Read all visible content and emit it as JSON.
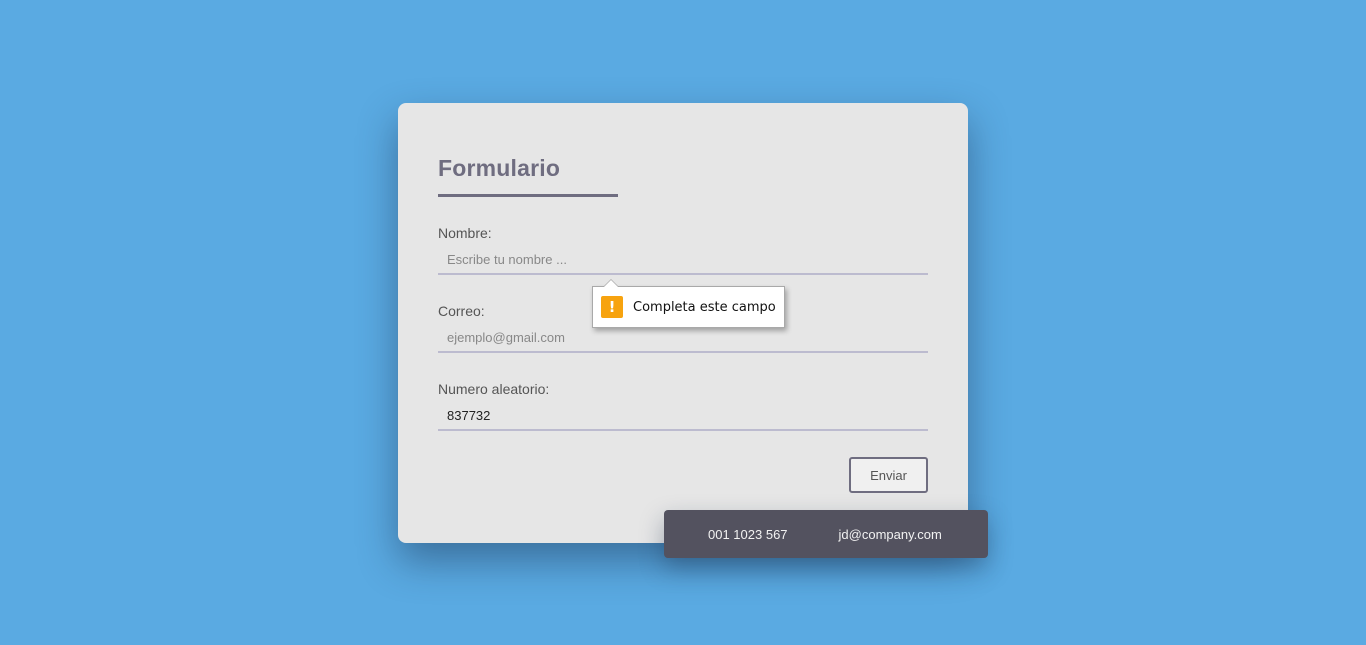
{
  "form": {
    "title": "Formulario",
    "fields": [
      {
        "label": "Nombre:",
        "placeholder": "Escribe tu nombre ...",
        "value": ""
      },
      {
        "label": "Correo:",
        "placeholder": "ejemplo@gmail.com",
        "value": ""
      },
      {
        "label": "Numero aleatorio:",
        "placeholder": "",
        "value": "837732"
      }
    ],
    "submit_label": "Enviar"
  },
  "validation": {
    "message": "Completa este campo",
    "icon": "warning-icon",
    "icon_glyph": "!"
  },
  "contact": {
    "phone": "001 1023 567",
    "email": "jd@company.com"
  },
  "colors": {
    "background": "#5aaae2",
    "card": "#e6e6e6",
    "accent": "#6f6d80",
    "warning": "#f7a30f",
    "info_bar": "#53525f"
  }
}
